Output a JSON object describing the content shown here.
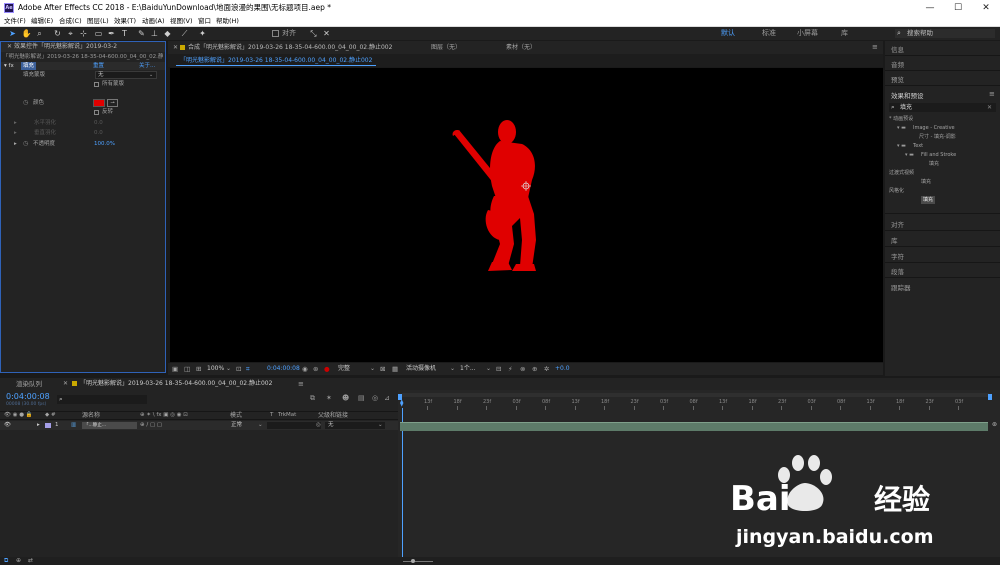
{
  "window": {
    "app_title": "Adobe After Effects CC 2018 - E:\\BaiduYunDownload\\地面浪漫的果围\\无标题项目.aep *",
    "logo_text": "Ae",
    "minimize": "—",
    "maximize": "☐",
    "close": "✕"
  },
  "menu": [
    "文件(F)",
    "编辑(E)",
    "合成(C)",
    "图层(L)",
    "效果(T)",
    "动画(A)",
    "视图(V)",
    "窗口",
    "帮助(H)"
  ],
  "toolbar": {
    "snap_label": "对齐",
    "workspaces": [
      "默认",
      "标准",
      "小屏幕",
      "库"
    ],
    "search_placeholder": "搜索帮助"
  },
  "effect_controls": {
    "tab_label": "效果控件「明光魅影解说」2019-03-2",
    "layer_path": "「明光魅影解说」2019-03-26 18-35-04-600.00_04_00_02.静止...",
    "effect_name": "填充",
    "reset_label": "重置",
    "about_label": "关于...",
    "fill_mask_label": "填充蒙版",
    "fill_mask_value": "无",
    "all_masks_label": "所有蒙版",
    "color_label": "颜色",
    "color_value": "#e00000",
    "invert_label": "反转",
    "h_feather_label": "水平羽化",
    "h_feather_value": "0.0",
    "v_feather_label": "垂直羽化",
    "v_feather_value": "0.0",
    "opacity_label": "不透明度",
    "opacity_value": "100.0%"
  },
  "composition": {
    "tab_label": "合成「明光魅影解说」2019-03-26 18-35-04-600.00_04_00_02.静止002",
    "layer_tab": "图层（无）",
    "footage_tab": "素材（无）",
    "sub_tab": "「明光魅影解说」2019-03-26 18-35-04-600.00_04_00_02.静止002",
    "zoom": "100%",
    "timecode": "0:04:00:08",
    "resolution": "完整",
    "camera": "活动摄像机",
    "views": "1个...",
    "exposure": "+0.0"
  },
  "right_panels": {
    "info": "信息",
    "audio": "音频",
    "preview": "预览",
    "effects_presets": "效果和预设",
    "search_value": "填充",
    "tree": [
      "* 动画预设",
      "Image - Creative",
      "尺寸 - 填充-调影",
      "Text",
      "Fill and Stroke",
      "填充",
      "过渡式视频",
      "填充",
      "风格化",
      "填充"
    ],
    "align": "对齐",
    "library": "库",
    "character": "字符",
    "paragraph": "段落",
    "tracker": "跟踪器"
  },
  "timeline": {
    "render_queue": "渲染队列",
    "comp_tab": "「明光魅影解说」2019-03-26 18-35-04-600.00_04_00_02.静止002",
    "timecode": "0:04:00:08",
    "frame_info": "00008 (30.00 fps)",
    "col_source": "源名称",
    "col_mode": "模式",
    "col_trkmat": "TrkMat",
    "col_parent": "父级和链接",
    "layer_number": "1",
    "layer_name": "「...静止...",
    "layer_mode": "正常",
    "layer_parent": "无",
    "ruler": [
      "13f",
      "18f",
      "23f",
      "03f",
      "08f",
      "13f",
      "18f",
      "23f",
      "03f",
      "08f",
      "13f",
      "18f",
      "23f",
      "03f",
      "08f",
      "13f",
      "18f",
      "23f",
      "03f"
    ]
  },
  "watermark": {
    "brand": "Bai",
    "brand2": "经验",
    "url": "jingyan.baidu.com"
  }
}
